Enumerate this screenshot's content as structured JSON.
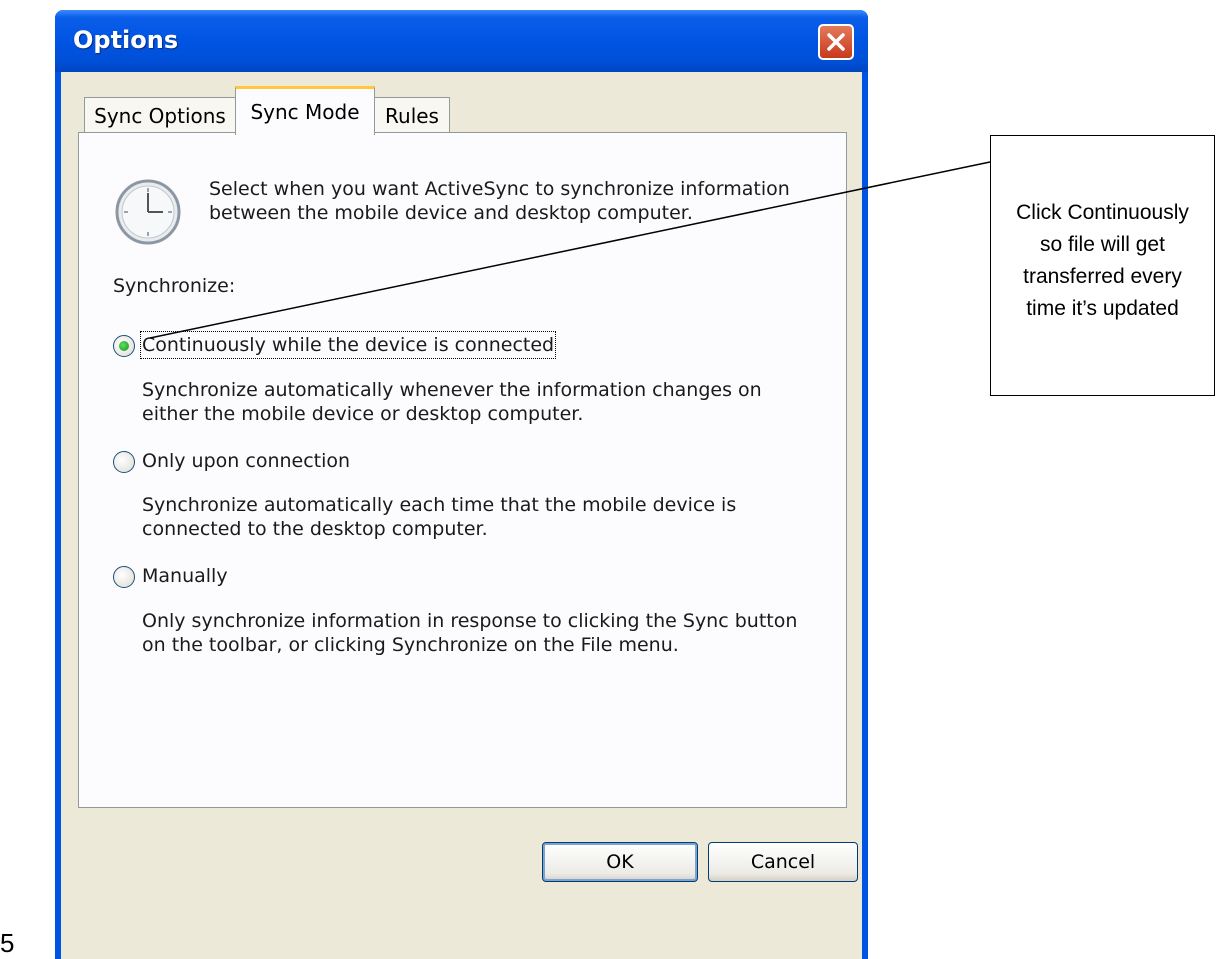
{
  "window": {
    "title": "Options",
    "tabs": [
      {
        "label": "Sync Options",
        "active": false
      },
      {
        "label": "Sync Mode",
        "active": true
      },
      {
        "label": "Rules",
        "active": false
      }
    ]
  },
  "panel": {
    "description_line1": "Select when you want ActiveSync to synchronize information",
    "description_line2": "between the mobile device and desktop computer.",
    "synchronize_label": "Synchronize:",
    "options": [
      {
        "label": "Continuously while the device is connected",
        "checked": true,
        "line1": "Synchronize automatically whenever the information changes on",
        "line2": "either the mobile device or desktop computer."
      },
      {
        "label": "Only upon connection",
        "checked": false,
        "line1": "Synchronize automatically each time that the mobile device is",
        "line2": "connected to the desktop computer."
      },
      {
        "label": "Manually",
        "checked": false,
        "line1": "Only synchronize information in response to clicking the Sync button",
        "line2": "on the toolbar, or clicking Synchronize on the File menu."
      }
    ]
  },
  "buttons": {
    "ok": "OK",
    "cancel": "Cancel"
  },
  "callout": {
    "text": "Click Continuously so file will get transferred every time it’s updated"
  },
  "page_number": "5",
  "icons": {
    "clock": "clock-icon",
    "close": "close-icon"
  },
  "colors": {
    "titlebar": "#0054e3",
    "close": "#c8391c",
    "tab_highlight": "#ffc83c",
    "radio_selected": "#1a8c1f"
  }
}
